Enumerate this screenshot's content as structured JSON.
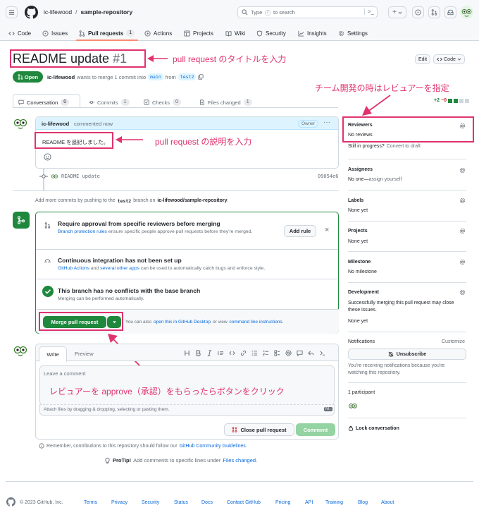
{
  "header": {
    "breadcrumb_owner": "ic-lifewood",
    "breadcrumb_sep": "/",
    "breadcrumb_repo": "sample-repository",
    "search_placeholder_pre": "Type",
    "search_key": "/",
    "search_placeholder_post": "to search",
    "plus_label": "+"
  },
  "repo_nav": {
    "tabs": [
      {
        "label": "Code"
      },
      {
        "label": "Issues"
      },
      {
        "label": "Pull requests",
        "count": "1"
      },
      {
        "label": "Actions"
      },
      {
        "label": "Projects"
      },
      {
        "label": "Wiki"
      },
      {
        "label": "Security"
      },
      {
        "label": "Insights"
      },
      {
        "label": "Settings"
      }
    ]
  },
  "pr": {
    "title": "README update",
    "number": "#1",
    "status": "Open",
    "author": "ic-lifewood",
    "merge_text_pre": "wants to merge 1 commit into",
    "base_branch": "main",
    "from_text": "from",
    "head_branch": "test2",
    "edit_label": "Edit",
    "code_label": "Code",
    "diff_add": "+2",
    "diff_del": "−0"
  },
  "pr_tabs": [
    {
      "label": "Conversation",
      "count": "0"
    },
    {
      "label": "Commits",
      "count": "1"
    },
    {
      "label": "Checks",
      "count": "0"
    },
    {
      "label": "Files changed",
      "count": "1"
    }
  ],
  "comment": {
    "author": "ic-lifewood",
    "action": "commented now",
    "badge": "Owner",
    "menu": "···",
    "body": "README を追記しました。"
  },
  "commit": {
    "message": "README update",
    "sha": "09054e6"
  },
  "push_hint": {
    "pre": "Add more commits by pushing to the",
    "branch": "test2",
    "mid": "branch on",
    "repo": "ic-lifewood/sample-repository",
    "post": "."
  },
  "merge": {
    "review_title": "Require approval from specific reviewers before merging",
    "review_link": "Branch protection rules",
    "review_text": "ensure specific people approve pull requests before they're merged.",
    "add_rule": "Add rule",
    "close_x": "×",
    "ci_title": "Continuous integration has not been set up",
    "ci_link1": "GitHub Actions",
    "ci_and": "and",
    "ci_link2": "several other apps",
    "ci_text": "can be used to automatically catch bugs and enforce style.",
    "conflict_title": "This branch has no conflicts with the base branch",
    "conflict_text": "Merging can be performed automatically.",
    "merge_button": "Merge pull request",
    "alt_pre": "You can also",
    "alt_link1": "open this in GitHub Desktop",
    "alt_mid": "or view",
    "alt_link2": "command line instructions",
    "alt_post": "."
  },
  "form": {
    "tab_write": "Write",
    "tab_preview": "Preview",
    "placeholder": "Leave a comment",
    "attach": "Attach files by dragging & dropping, selecting or pasting them.",
    "md_badge": "M↓",
    "close_pr": "Close pull request",
    "comment_btn": "Comment",
    "remember_pre": "Remember, contributions to this repository should follow our",
    "remember_link": "GitHub Community Guidelines",
    "remember_post": ".",
    "protip_label": "ProTip!",
    "protip_text": "Add comments to specific lines under",
    "protip_link": "Files changed",
    "protip_post": "."
  },
  "sidebar": {
    "reviewers_title": "Reviewers",
    "reviewers_value": "No reviews",
    "still_progress": "Still in progress?",
    "convert_draft": "Convert to draft",
    "assignees_title": "Assignees",
    "assignees_value": "No one—",
    "assign_yourself": "assign yourself",
    "labels_title": "Labels",
    "labels_value": "None yet",
    "projects_title": "Projects",
    "projects_value": "None yet",
    "milestone_title": "Milestone",
    "milestone_value": "No milestone",
    "development_title": "Development",
    "development_text": "Successfully merging this pull request may close these issues.",
    "development_value": "None yet",
    "notifications_title": "Notifications",
    "customize": "Customize",
    "unsubscribe": "Unsubscribe",
    "notif_text": "You're receiving notifications because you're watching this repository.",
    "participants": "1 participant",
    "lock": "Lock conversation"
  },
  "annotations": {
    "title_note": "pull request のタイトルを入力",
    "desc_note": "pull request の説明を入力",
    "review_note": "チーム開発の時はレビュアーを指定",
    "merge_note": "レビュアーを approve（承認）をもらったらボタンをクリック"
  },
  "footer": {
    "copyright": "© 2023 GitHub, Inc.",
    "links": [
      "Terms",
      "Privacy",
      "Security",
      "Status",
      "Docs",
      "Contact GitHub",
      "Pricing",
      "API",
      "Training",
      "Blog",
      "About"
    ]
  },
  "colors": {
    "accent_green": "#1f883d",
    "link_blue": "#0969da",
    "annotation_pink": "#e0336d",
    "tab_underline": "#fd8c73"
  }
}
